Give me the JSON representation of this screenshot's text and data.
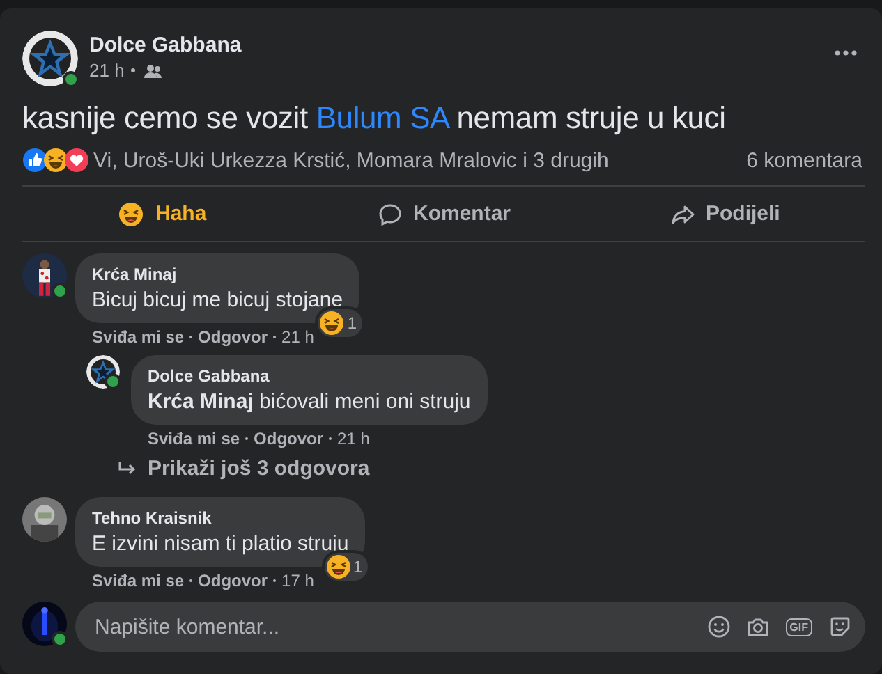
{
  "post": {
    "author": "Dolce Gabbana",
    "time": "21 h",
    "online": true,
    "text": "kasnije cemo se vozit ",
    "mention": "Bulum SA",
    "text_after": " nemam struje u kuci",
    "reacted_by": "Vi, Uroš-Uki Urkezza Krstić, Momara Mralovic i 3 drugih",
    "comment_count": "6 komentara"
  },
  "actions": [
    {
      "kind": "haha",
      "label": "Haha",
      "selected": true
    },
    {
      "kind": "comment",
      "label": "Komentar",
      "selected": false
    },
    {
      "kind": "share",
      "label": "Podijeli",
      "selected": false
    }
  ],
  "comments": [
    {
      "author": "Krća Minaj",
      "text": "Bicuj bicuj me bicuj stojane",
      "online": true,
      "reaction_count": "1",
      "like": "Sviđa mi se",
      "reply": "Odgovor",
      "time": "21 h",
      "children": [
        {
          "author": "Dolce Gabbana",
          "text": "**Krća Minaj** bićovali meni oni struju",
          "online": true,
          "like": "Sviđa mi se",
          "reply": "Odgovor",
          "time": "21 h"
        }
      ],
      "more_replies": "Prikaži još 3 odgovora"
    },
    {
      "author": "Tehno Kraisnik",
      "text": "E izvini nisam ti platio struju",
      "online": false,
      "reaction_count": "1",
      "like": "Sviđa mi se",
      "reply": "Odgovor",
      "time": "17 h"
    }
  ],
  "composer": {
    "placeholder": "Napišite komentar...",
    "online": true,
    "gif_label": "GIF"
  }
}
